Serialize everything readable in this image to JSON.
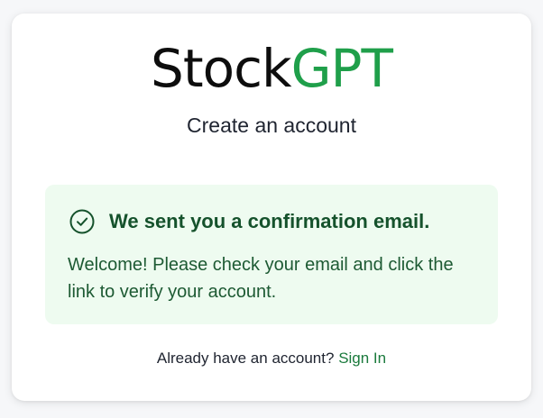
{
  "brand": {
    "name_part1": "Stock",
    "name_part2": "GPT",
    "accent_color": "#1f9f4a"
  },
  "subtitle": "Create an account",
  "alert": {
    "icon": "check-circle-icon",
    "title": "We sent you a confirmation email.",
    "body": "Welcome! Please check your email and click the link to verify your account.",
    "background_color": "#eefbf0",
    "text_color": "#15522c"
  },
  "footer": {
    "prompt": "Already have an account?",
    "link_label": "Sign In"
  }
}
